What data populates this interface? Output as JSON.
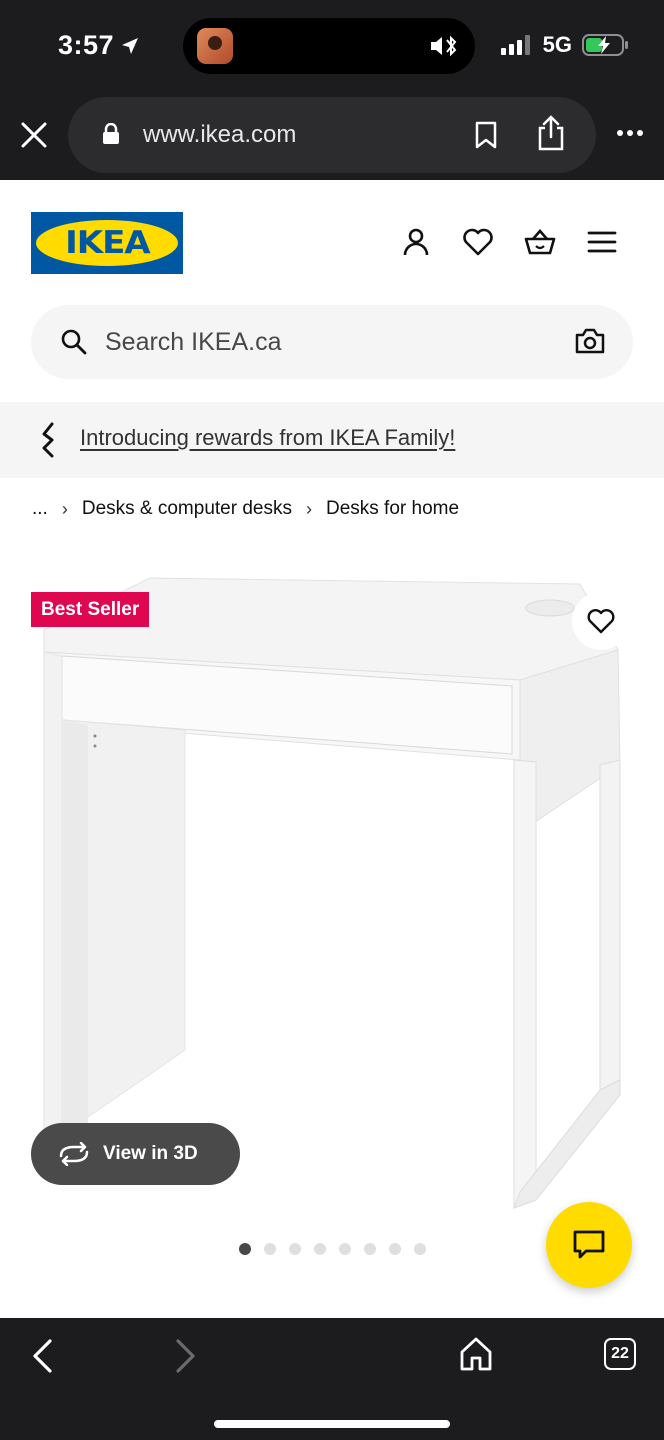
{
  "status_bar": {
    "time": "3:57",
    "network": "5G"
  },
  "browser": {
    "url": "www.ikea.com",
    "tab_count": "22"
  },
  "header": {
    "logo_text": "IKEA",
    "icons": [
      "account-icon",
      "heart-icon",
      "cart-icon",
      "menu-icon"
    ]
  },
  "search": {
    "placeholder": "Search IKEA.ca"
  },
  "promo": {
    "link_text": "Introducing rewards from IKEA Family!"
  },
  "breadcrumb": {
    "ellipsis": "...",
    "items": [
      "Desks & computer desks",
      "Desks for home"
    ]
  },
  "product": {
    "badge": "Best Seller",
    "badge_color": "#e00751",
    "view_3d_label": "View in 3D",
    "carousel_total": 8,
    "carousel_active": 1
  },
  "colors": {
    "ikea_blue": "#0058a3",
    "ikea_yellow": "#ffdb00",
    "chrome_dark": "#1c1c1e"
  }
}
